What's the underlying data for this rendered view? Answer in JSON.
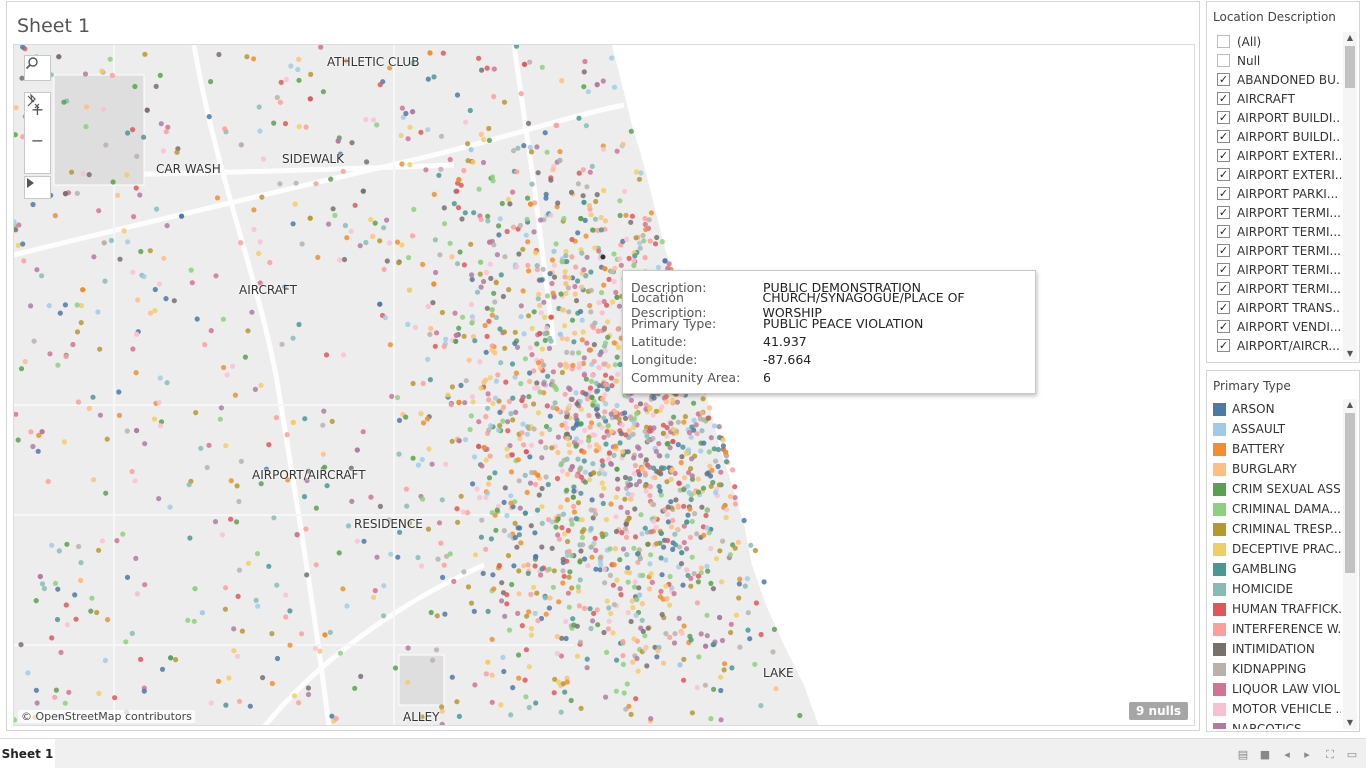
{
  "sheet": {
    "title": "Sheet 1"
  },
  "map": {
    "labels": [
      "ATHLETIC CLUB",
      "CAR WASH",
      "SIDEWALK",
      "AIRCRAFT",
      "AIRPORT/AIRCRAFT",
      "RESIDENCE",
      "LAKE",
      "ALLEY"
    ],
    "attribution": "© OpenStreetMap contributors",
    "nulls": "9 nulls",
    "controls": {
      "search_icon": "search-icon",
      "zoom_in": "+",
      "zoom_out": "−",
      "pin_icon": "pin-reset-icon",
      "play_icon": "play-icon"
    }
  },
  "tooltip": {
    "rows": [
      {
        "key": "Description:",
        "value": "PUBLIC DEMONSTRATION"
      },
      {
        "key": "Location Description:",
        "value": "CHURCH/SYNAGOGUE/PLACE OF WORSHIP"
      },
      {
        "key": "Primary Type:",
        "value": "PUBLIC PEACE VIOLATION"
      },
      {
        "key": "Latitude:",
        "value": "41.937"
      },
      {
        "key": "Longitude:",
        "value": "-87.664"
      },
      {
        "key": "Community Area:",
        "value": "6"
      }
    ]
  },
  "location_filter": {
    "title": "Location Description",
    "items": [
      {
        "label": "(All)",
        "checked": false
      },
      {
        "label": "Null",
        "checked": false
      },
      {
        "label": "ABANDONED BU...",
        "checked": true
      },
      {
        "label": "AIRCRAFT",
        "checked": true
      },
      {
        "label": "AIRPORT BUILDI...",
        "checked": true
      },
      {
        "label": "AIRPORT BUILDI...",
        "checked": true
      },
      {
        "label": "AIRPORT EXTERI...",
        "checked": true
      },
      {
        "label": "AIRPORT EXTERI...",
        "checked": true
      },
      {
        "label": "AIRPORT PARKI...",
        "checked": true
      },
      {
        "label": "AIRPORT TERMI...",
        "checked": true
      },
      {
        "label": "AIRPORT TERMI...",
        "checked": true
      },
      {
        "label": "AIRPORT TERMI...",
        "checked": true
      },
      {
        "label": "AIRPORT TERMI...",
        "checked": true
      },
      {
        "label": "AIRPORT TERMI...",
        "checked": true
      },
      {
        "label": "AIRPORT TRANS...",
        "checked": true
      },
      {
        "label": "AIRPORT VENDI...",
        "checked": true
      },
      {
        "label": "AIRPORT/AIRCR...",
        "checked": true
      }
    ]
  },
  "type_legend": {
    "title": "Primary Type",
    "items": [
      {
        "label": "ARSON",
        "color": "#4e79a7"
      },
      {
        "label": "ASSAULT",
        "color": "#a0cbe8"
      },
      {
        "label": "BATTERY",
        "color": "#f28e2b"
      },
      {
        "label": "BURGLARY",
        "color": "#ffbe7d"
      },
      {
        "label": "CRIM SEXUAL ASS...",
        "color": "#59a14f"
      },
      {
        "label": "CRIMINAL DAMA...",
        "color": "#8cd17d"
      },
      {
        "label": "CRIMINAL TRESP...",
        "color": "#b6992d"
      },
      {
        "label": "DECEPTIVE PRAC...",
        "color": "#f1ce63"
      },
      {
        "label": "GAMBLING",
        "color": "#499894"
      },
      {
        "label": "HOMICIDE",
        "color": "#86bcb6"
      },
      {
        "label": "HUMAN TRAFFICK...",
        "color": "#e15759"
      },
      {
        "label": "INTERFERENCE W...",
        "color": "#ff9d9a"
      },
      {
        "label": "INTIMIDATION",
        "color": "#79706e"
      },
      {
        "label": "KIDNAPPING",
        "color": "#bab0ac"
      },
      {
        "label": "LIQUOR LAW VIOL...",
        "color": "#d37295"
      },
      {
        "label": "MOTOR VEHICLE ...",
        "color": "#fabfd2"
      },
      {
        "label": "NARCOTICS",
        "color": "#b07aa1"
      }
    ]
  },
  "bottom_bar": {
    "tab": "Sheet 1",
    "icons": [
      "grid-view-icon",
      "filmstrip-icon",
      "prev-icon",
      "next-icon",
      "fullscreen-icon",
      "presentation-icon"
    ]
  }
}
